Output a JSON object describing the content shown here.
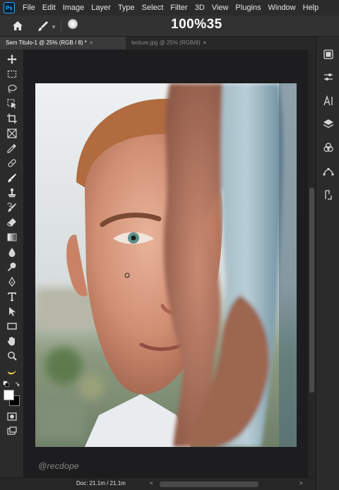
{
  "app": {
    "logo_text": "Ps"
  },
  "menu": [
    "File",
    "Edit",
    "Image",
    "Layer",
    "Type",
    "Select",
    "Filter",
    "3D",
    "View",
    "Plugins",
    "Window",
    "Help"
  ],
  "options": {
    "zoom_overlay": "100%35"
  },
  "tabs": [
    {
      "label": "Sem Titulo-1 @ 25% (RGB / 8) *",
      "close": "×",
      "active": true
    },
    {
      "label": "texture.jpg @ 25% (RGB/8)",
      "close": "×",
      "active": false
    }
  ],
  "toolbar": {
    "tools": [
      "move-tool-icon",
      "marquee-tool-icon",
      "lasso-tool-icon",
      "object-select-icon",
      "crop-tool-icon",
      "frame-tool-icon",
      "eyedropper-icon",
      "healing-brush-icon",
      "brush-tool-icon",
      "clone-stamp-icon",
      "history-brush-icon",
      "eraser-icon",
      "gradient-icon",
      "blur-icon",
      "dodge-icon",
      "pen-tool-icon",
      "type-tool-icon",
      "path-select-icon",
      "rectangle-tool-icon",
      "hand-tool-icon",
      "zoom-tool-icon",
      "banana-icon",
      "swap-colors-icon",
      "quick-mask-icon",
      "screen-mode-icon"
    ],
    "foreground_color": "#ffffff",
    "background_color": "#000000"
  },
  "status": {
    "doc_info": "Doc: 21.1m / 21.1m",
    "left_arrow": "<",
    "right_arrow": ">"
  },
  "watermark": "@recdope",
  "right_panel": [
    "libraries-icon",
    "adjustments-icon",
    "character-icon",
    "layers-icon",
    "channels-icon",
    "paths-icon",
    "history-icon"
  ],
  "colors": {
    "accent": "#31a8ff",
    "panel": "#2b2b2b",
    "canvas_bg": "#1d1d1f"
  }
}
